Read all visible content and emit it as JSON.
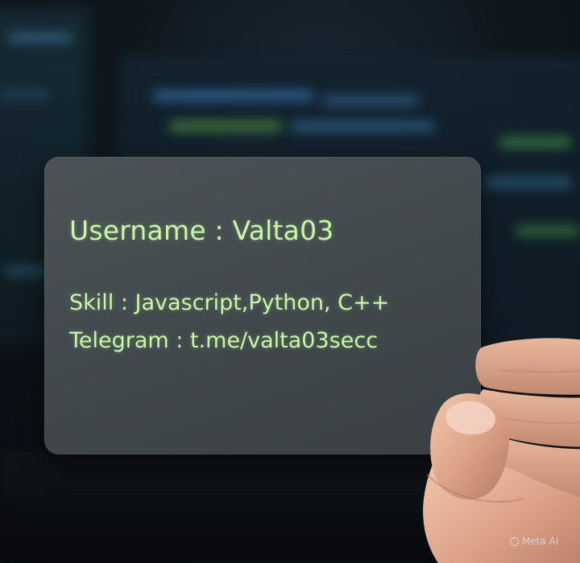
{
  "card": {
    "username_line": "Username : Valta03",
    "skill_line": "Skill : Javascript,Python, C++",
    "telegram_line": "Telegram : t.me/valta03secc"
  },
  "watermark": {
    "text": "Meta AI"
  },
  "colors": {
    "card_text": "#c8f7a8",
    "card_background": "#454c50",
    "scene_background": "#0c1116"
  },
  "icons": {
    "watermark_logo": "meta-ai-ring-icon"
  }
}
